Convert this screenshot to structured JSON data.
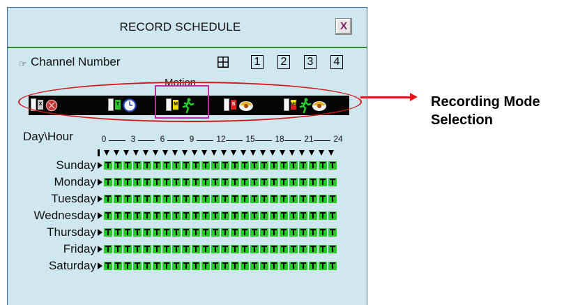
{
  "window": {
    "title": "RECORD SCHEDULE",
    "close_glyph": "X"
  },
  "channel": {
    "label": "Channel Number",
    "pointer_icon": "hand-pointer-icon",
    "grid_icon": "quad-view-icon",
    "buttons": [
      "1",
      "2",
      "3",
      "4"
    ]
  },
  "modes": {
    "motion_label": "Motion",
    "items": [
      {
        "name": "no-record",
        "tag": "X",
        "icon": "no-record-icon"
      },
      {
        "name": "timer",
        "tag": "T",
        "icon": "clock-icon"
      },
      {
        "name": "motion",
        "tag": "M",
        "icon": "running-man-icon"
      },
      {
        "name": "sensor",
        "tag": "S",
        "icon": "sensor-eye-icon"
      },
      {
        "name": "motion-sensor",
        "tag": "MS",
        "icon": "running-man-sensor-icon"
      }
    ],
    "selected": "motion",
    "colors": {
      "x": "#c8c8c8",
      "t": "#28c828",
      "m": "#f0e000",
      "s": "#e02020"
    }
  },
  "schedule": {
    "corner_label": "Day\\Hour",
    "hours": [
      "0",
      "3",
      "6",
      "9",
      "12",
      "15",
      "18",
      "21",
      "24"
    ],
    "days": [
      "Sunday",
      "Monday",
      "Tuesday",
      "Wednesday",
      "Thursday",
      "Friday",
      "Saturday"
    ],
    "cell_mode": "T",
    "cell_color": "#28c828",
    "slots_per_day": 24
  },
  "annotation": {
    "line1": "Recording Mode",
    "line2": "Selection",
    "color": "#e01a1a"
  }
}
